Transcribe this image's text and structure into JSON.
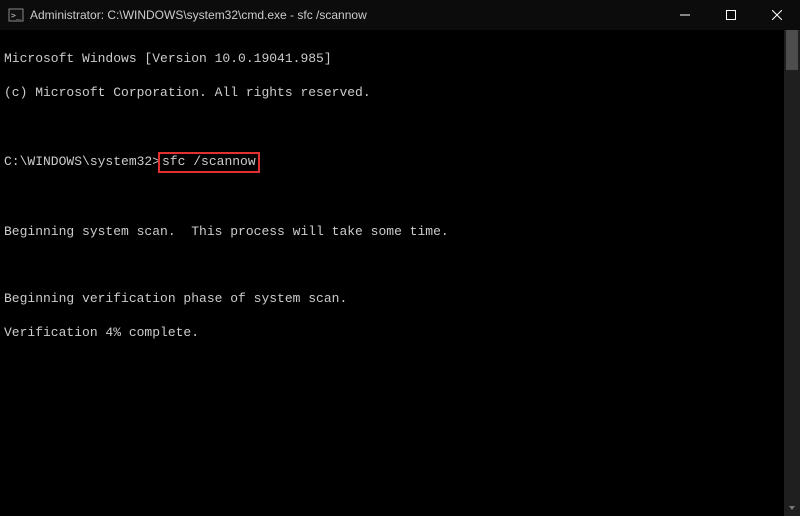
{
  "titlebar": {
    "title": "Administrator: C:\\WINDOWS\\system32\\cmd.exe - sfc  /scannow"
  },
  "console": {
    "version_line": "Microsoft Windows [Version 10.0.19041.985]",
    "copyright_line": "(c) Microsoft Corporation. All rights reserved.",
    "prompt": "C:\\WINDOWS\\system32>",
    "command": "sfc /scannow",
    "scan_begin": "Beginning system scan.  This process will take some time.",
    "verification_phase": "Beginning verification phase of system scan.",
    "verification_progress": "Verification 4% complete."
  },
  "highlight_color": "#e03030"
}
